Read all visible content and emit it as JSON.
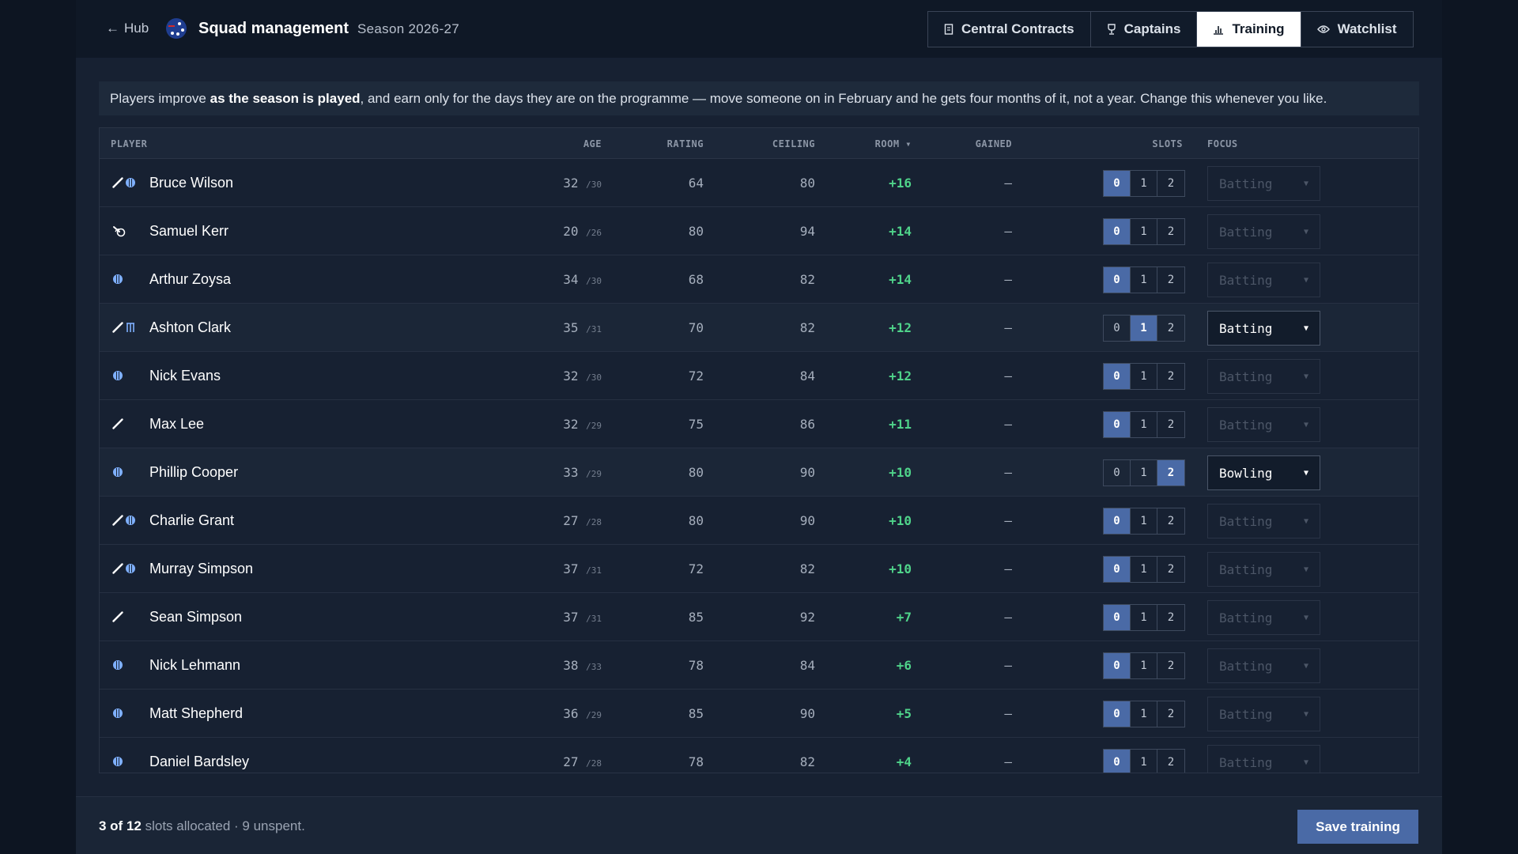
{
  "header": {
    "back_label": "Hub",
    "title": "Squad management",
    "season": "Season 2026-27",
    "tabs": [
      {
        "label": "Central Contracts",
        "icon": "document-icon",
        "active": false
      },
      {
        "label": "Captains",
        "icon": "trophy-icon",
        "active": false
      },
      {
        "label": "Training",
        "icon": "bar-chart-icon",
        "active": true
      },
      {
        "label": "Watchlist",
        "icon": "eye-icon",
        "active": false
      }
    ]
  },
  "info": {
    "before": "Players improve ",
    "bold": "as the season is played",
    "after": ", and earn only for the days they are on the programme — move someone on in February and he gets four months of it, not a year. Change this whenever you like."
  },
  "table": {
    "columns": {
      "player": "PLAYER",
      "age": "AGE",
      "rating": "RATING",
      "ceiling": "CEILING",
      "room": "ROOM ▾",
      "gained": "GAINED",
      "slots": "SLOTS",
      "focus": "FOCUS"
    },
    "slot_options": [
      "0",
      "1",
      "2"
    ],
    "rows": [
      {
        "name": "Bruce Wilson",
        "roles": [
          "bat",
          "ball"
        ],
        "age": "32",
        "peak": "/30",
        "rating": "64",
        "ceiling": "80",
        "room": "+16",
        "gained": "–",
        "slots": 0,
        "focus": "Batting"
      },
      {
        "name": "Samuel Kerr",
        "roles": [
          "spin"
        ],
        "age": "20",
        "peak": "/26",
        "rating": "80",
        "ceiling": "94",
        "room": "+14",
        "gained": "–",
        "slots": 0,
        "focus": "Batting"
      },
      {
        "name": "Arthur Zoysa",
        "roles": [
          "ball"
        ],
        "age": "34",
        "peak": "/30",
        "rating": "68",
        "ceiling": "82",
        "room": "+14",
        "gained": "–",
        "slots": 0,
        "focus": "Batting"
      },
      {
        "name": "Ashton Clark",
        "roles": [
          "bat",
          "stumps"
        ],
        "age": "35",
        "peak": "/31",
        "rating": "70",
        "ceiling": "82",
        "room": "+12",
        "gained": "–",
        "slots": 1,
        "focus": "Batting"
      },
      {
        "name": "Nick Evans",
        "roles": [
          "ball"
        ],
        "age": "32",
        "peak": "/30",
        "rating": "72",
        "ceiling": "84",
        "room": "+12",
        "gained": "–",
        "slots": 0,
        "focus": "Batting"
      },
      {
        "name": "Max Lee",
        "roles": [
          "bat"
        ],
        "age": "32",
        "peak": "/29",
        "rating": "75",
        "ceiling": "86",
        "room": "+11",
        "gained": "–",
        "slots": 0,
        "focus": "Batting"
      },
      {
        "name": "Phillip Cooper",
        "roles": [
          "ball"
        ],
        "age": "33",
        "peak": "/29",
        "rating": "80",
        "ceiling": "90",
        "room": "+10",
        "gained": "–",
        "slots": 2,
        "focus": "Bowling"
      },
      {
        "name": "Charlie Grant",
        "roles": [
          "bat",
          "ball"
        ],
        "age": "27",
        "peak": "/28",
        "rating": "80",
        "ceiling": "90",
        "room": "+10",
        "gained": "–",
        "slots": 0,
        "focus": "Batting"
      },
      {
        "name": "Murray Simpson",
        "roles": [
          "bat",
          "ball"
        ],
        "age": "37",
        "peak": "/31",
        "rating": "72",
        "ceiling": "82",
        "room": "+10",
        "gained": "–",
        "slots": 0,
        "focus": "Batting"
      },
      {
        "name": "Sean Simpson",
        "roles": [
          "bat"
        ],
        "age": "37",
        "peak": "/31",
        "rating": "85",
        "ceiling": "92",
        "room": "+7",
        "gained": "–",
        "slots": 0,
        "focus": "Batting"
      },
      {
        "name": "Nick Lehmann",
        "roles": [
          "ball"
        ],
        "age": "38",
        "peak": "/33",
        "rating": "78",
        "ceiling": "84",
        "room": "+6",
        "gained": "–",
        "slots": 0,
        "focus": "Batting"
      },
      {
        "name": "Matt Shepherd",
        "roles": [
          "ball"
        ],
        "age": "36",
        "peak": "/29",
        "rating": "85",
        "ceiling": "90",
        "room": "+5",
        "gained": "–",
        "slots": 0,
        "focus": "Batting"
      },
      {
        "name": "Daniel Bardsley",
        "roles": [
          "ball"
        ],
        "age": "27",
        "peak": "/28",
        "rating": "78",
        "ceiling": "82",
        "room": "+4",
        "gained": "–",
        "slots": 0,
        "focus": "Batting"
      }
    ]
  },
  "footer": {
    "allocated": "3 of 12",
    "rest": " slots allocated · 9 unspent.",
    "save_label": "Save training"
  },
  "colors": {
    "accent": "#4a6aa6",
    "positive": "#4fd38a",
    "background": "#0d1522",
    "ball_icon": "#7fb0ff"
  }
}
